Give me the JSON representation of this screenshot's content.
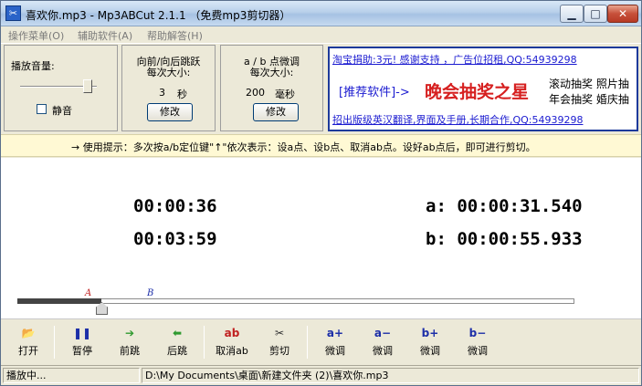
{
  "window": {
    "title": "喜欢你.mp3 - Mp3ABCut 2.1.1 （免费mp3剪切器）",
    "icon_label": "✂"
  },
  "menu": [
    "操作菜单(O)",
    "辅助软件(A)",
    "帮助解答(H)"
  ],
  "volume": {
    "label": "播放音量:",
    "mute_label": "静音",
    "level": 0.85,
    "muted": false
  },
  "jump": {
    "line1": "向前/向后跳跃",
    "line2": "每次大小:",
    "value": "3",
    "unit": "秒",
    "edit_label": "修改"
  },
  "ab_adjust": {
    "line1": "a / b 点微调",
    "line2": "每次大小:",
    "value": "200",
    "unit": "毫秒",
    "edit_label": "修改"
  },
  "ad": {
    "top_link": "淘宝捐助:3元! 感谢支持 ，广告位招租,QQ:54939298",
    "recommend": "[推荐软件]->",
    "headline": "晚会抽奖之星",
    "side_1": "滚动抽奖 照片抽",
    "side_2": "年会抽奖 婚庆抽",
    "bottom_link": "招出版级英汉翻译,界面及手册,长期合作,QQ:54939298"
  },
  "hint": "→ 使用提示：多次按a/b定位键\"↑\"依次表示：设a点、设b点、取消ab点。设好ab点后，即可进行剪切。",
  "times": {
    "current": "00:00:36",
    "total": "00:03:59",
    "a_point": "a: 00:00:31.540",
    "b_point": "b: 00:00:55.933"
  },
  "seek": {
    "marker_a": "A",
    "marker_b": "B",
    "progress": 0.15
  },
  "toolbar": [
    {
      "name": "open-button",
      "icon": "📂",
      "label": "打开",
      "color": "#b08a2a"
    },
    {
      "name": "pause-button",
      "icon": "❚❚",
      "label": "暂停",
      "color": "#1d2fa8"
    },
    {
      "name": "forward-button",
      "icon": "➔",
      "label": "前跳",
      "color": "#2f9a2f"
    },
    {
      "name": "back-button",
      "icon": "⬅",
      "label": "后跳",
      "color": "#2f9a2f"
    },
    {
      "name": "cancel-ab-button",
      "icon": "ab",
      "label": "取消ab",
      "color": "#c02020"
    },
    {
      "name": "cut-button",
      "icon": "✂",
      "label": "剪切",
      "color": "#333333"
    },
    {
      "name": "a-plus-button",
      "icon": "a+",
      "label": "微调",
      "color": "#1d2fa8"
    },
    {
      "name": "a-minus-button",
      "icon": "a−",
      "label": "微调",
      "color": "#1d2fa8"
    },
    {
      "name": "b-plus-button",
      "icon": "b+",
      "label": "微调",
      "color": "#1d2fa8"
    },
    {
      "name": "b-minus-button",
      "icon": "b−",
      "label": "微调",
      "color": "#1d2fa8"
    }
  ],
  "status": {
    "state": "播放中...",
    "path": "D:\\My Documents\\桌面\\新建文件夹 (2)\\喜欢你.mp3"
  }
}
